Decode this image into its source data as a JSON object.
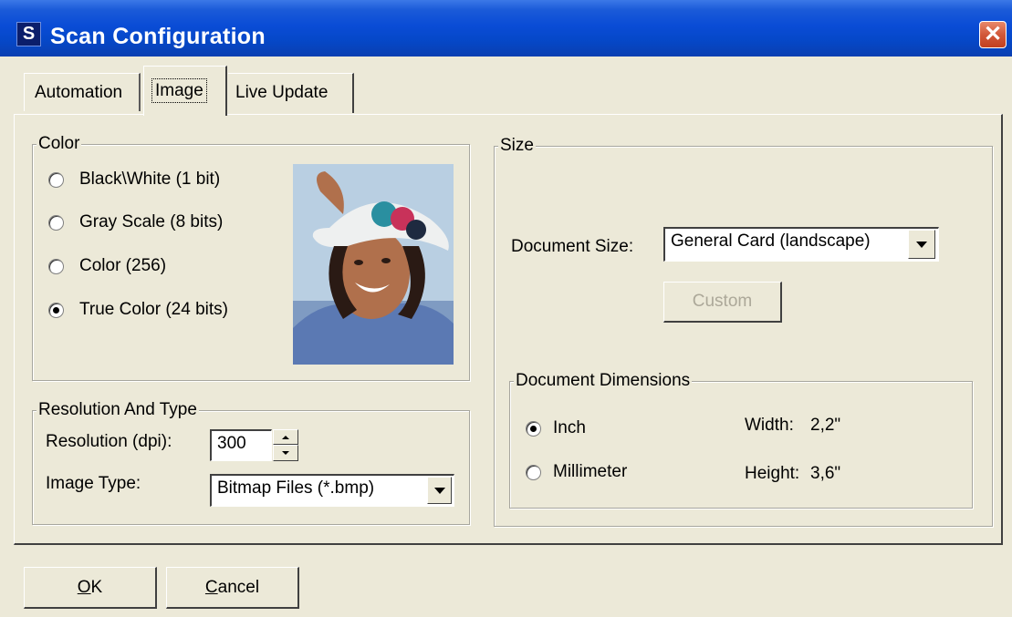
{
  "window": {
    "title": "Scan Configuration",
    "app_icon_glyph": "S",
    "close_glyph": "✕"
  },
  "tabs": [
    {
      "label": "Automation"
    },
    {
      "label": "Image",
      "active": true
    },
    {
      "label": "Live Update"
    }
  ],
  "color_group": {
    "title": "Color",
    "options": [
      {
        "label": "Black\\White (1 bit)",
        "checked": false
      },
      {
        "label": "Gray Scale (8 bits)",
        "checked": false
      },
      {
        "label": "Color (256)",
        "checked": false
      },
      {
        "label": "True Color (24 bits)",
        "checked": true
      }
    ],
    "preview_image": "sample-portrait-photo"
  },
  "resolution_group": {
    "title": "Resolution And Type",
    "resolution_label": "Resolution (dpi):",
    "resolution_value": "300",
    "image_type_label": "Image Type:",
    "image_type_value": "Bitmap Files (*.bmp)"
  },
  "size_group": {
    "title": "Size",
    "document_size_label": "Document Size:",
    "document_size_value": "General Card (landscape)",
    "custom_button": "Custom",
    "dimensions": {
      "title": "Document Dimensions",
      "units": [
        {
          "label": "Inch",
          "checked": true
        },
        {
          "label": "Millimeter",
          "checked": false
        }
      ],
      "width_label": "Width:",
      "width_value": "2,2\"",
      "height_label": "Height:",
      "height_value": "3,6\""
    }
  },
  "footer": {
    "ok_underlined": "O",
    "ok_rest": "K",
    "cancel_underlined": "C",
    "cancel_rest": "ancel"
  },
  "colors": {
    "titlebar": "#0a4cd6",
    "dialog_bg": "#ece9d8",
    "close_button": "#d2583a",
    "disabled_text": "#aca899"
  },
  "icons": [
    "app-icon",
    "close-icon",
    "chevron-down-icon",
    "spin-up-icon",
    "spin-down-icon"
  ]
}
